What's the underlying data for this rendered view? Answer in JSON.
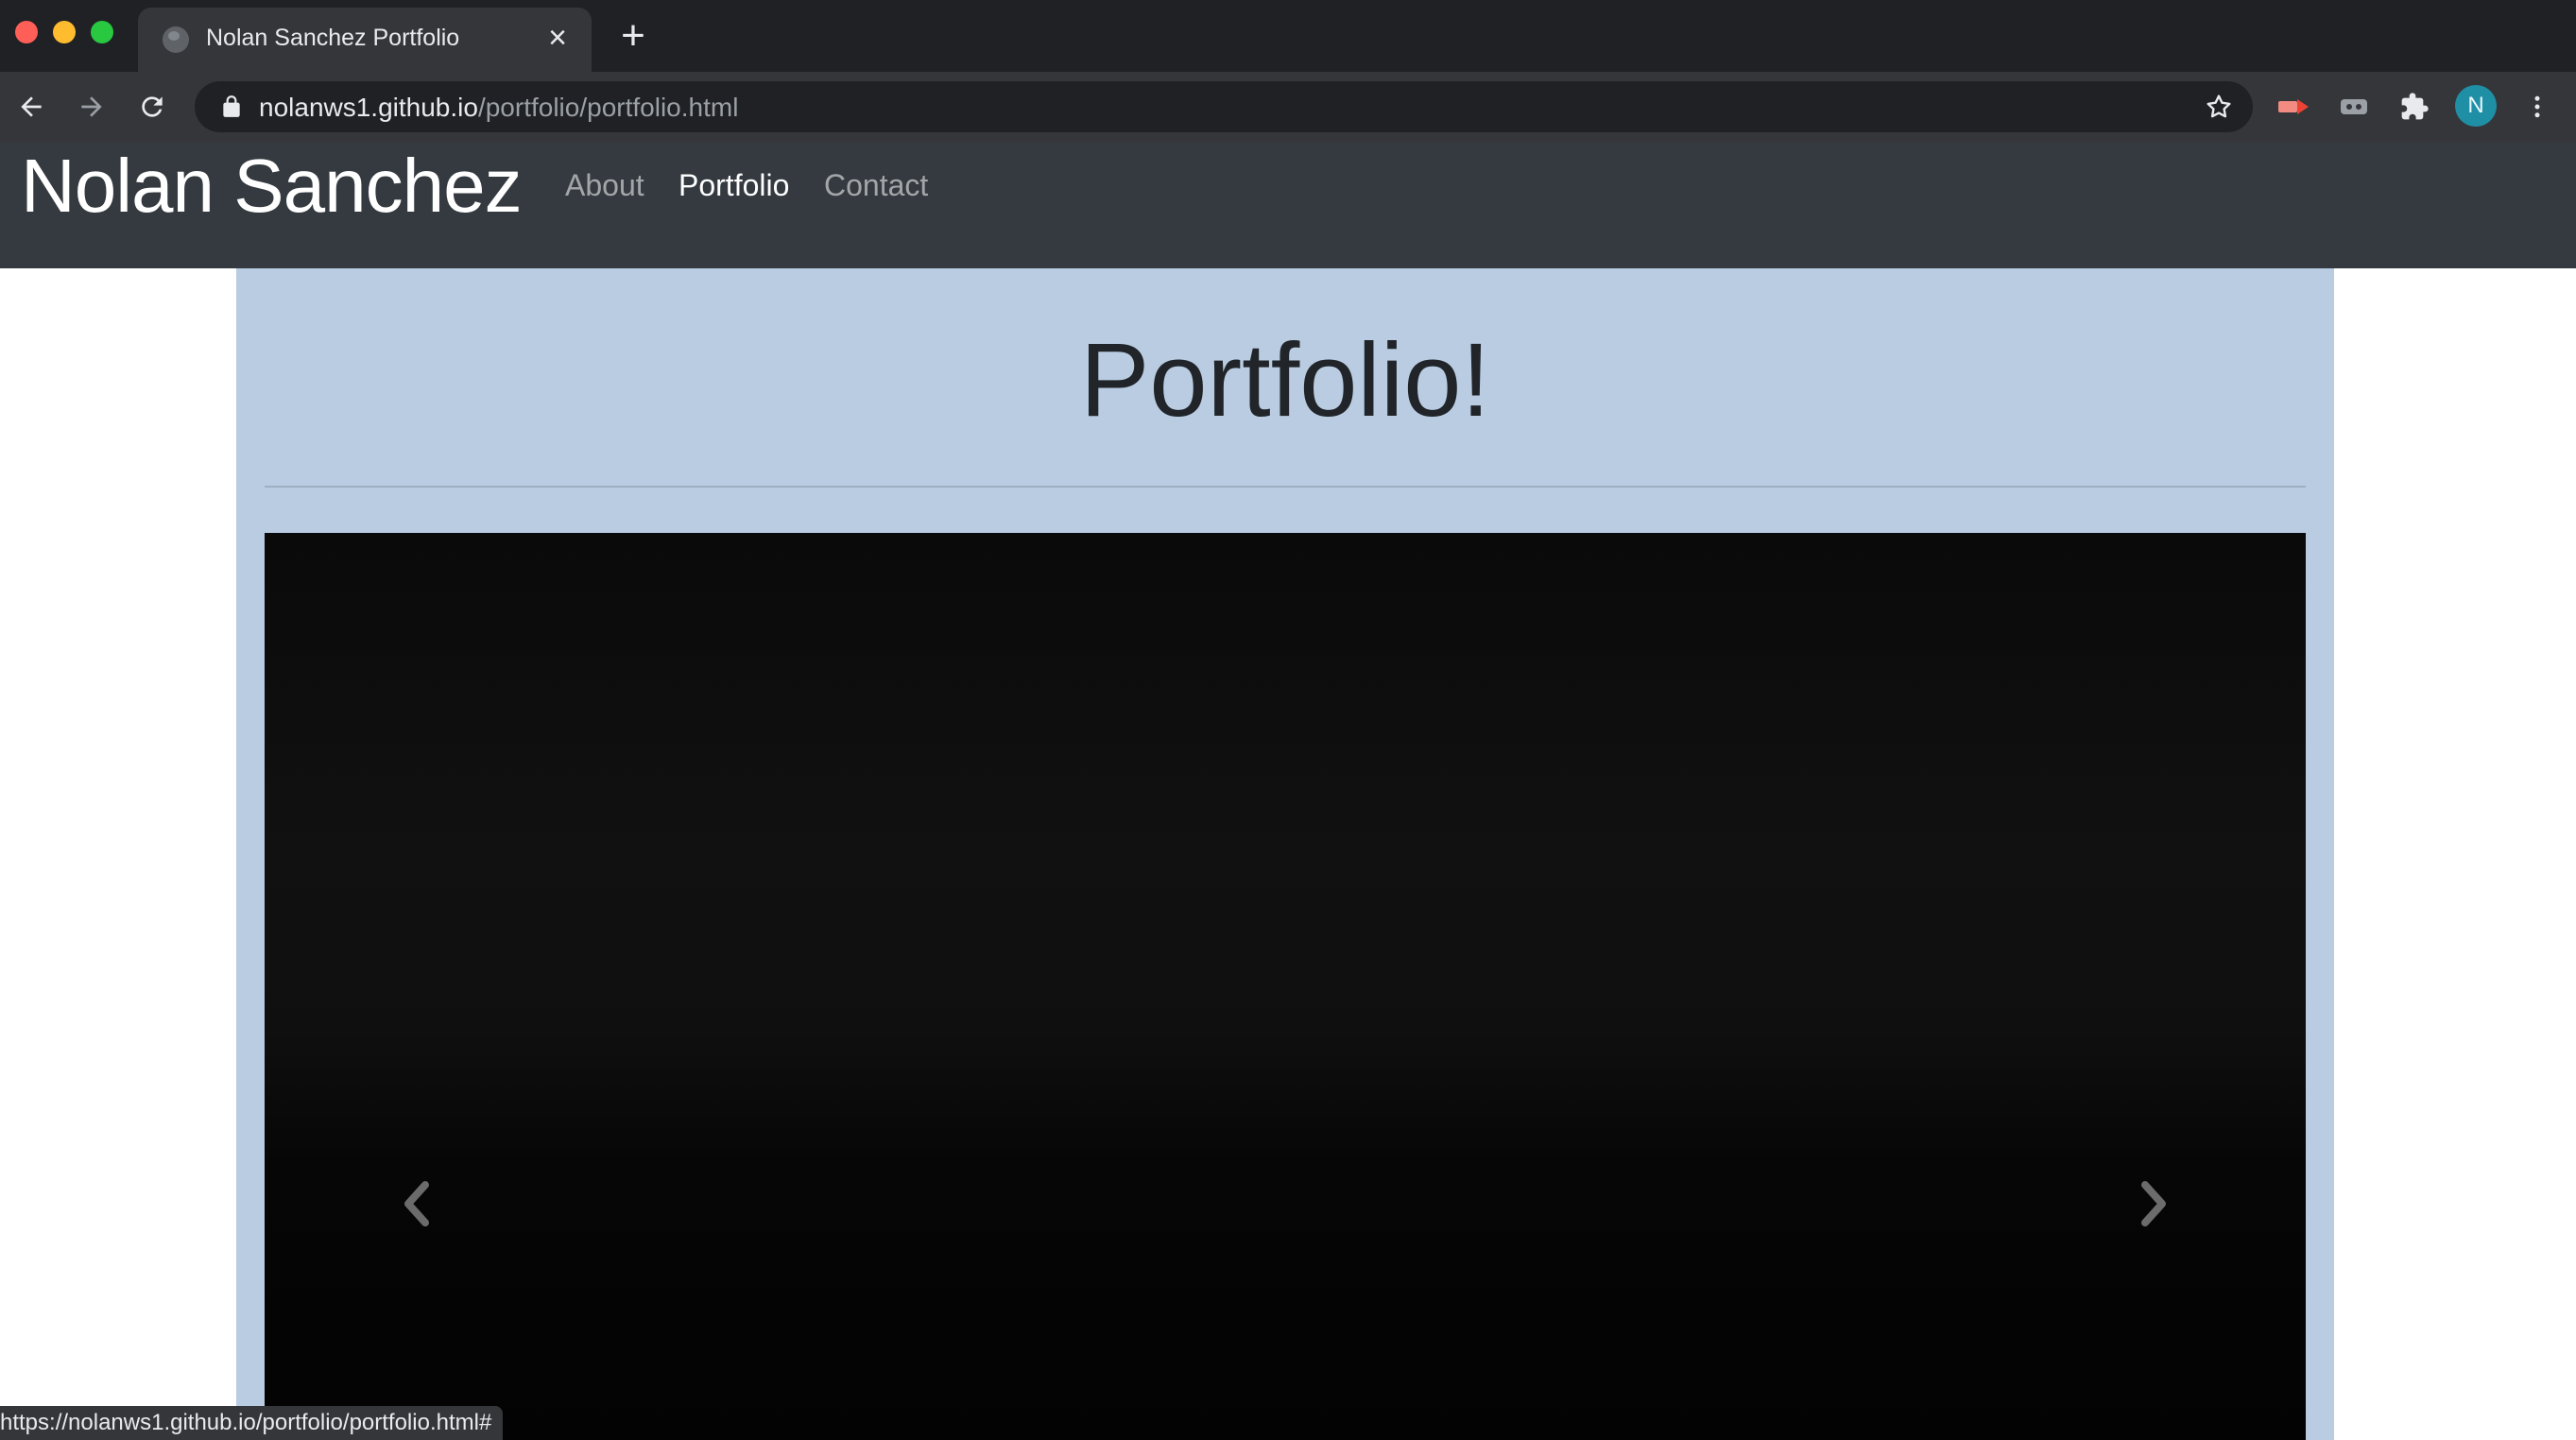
{
  "browser": {
    "tab": {
      "title": "Nolan Sanchez Portfolio"
    },
    "address": {
      "domain": "nolanws1.github.io",
      "path": "/portfolio/portfolio.html"
    },
    "profile_initial": "N",
    "status_url": "https://nolanws1.github.io/portfolio/portfolio.html#"
  },
  "site": {
    "brand": "Nolan Sanchez",
    "nav": {
      "about": "About",
      "portfolio": "Portfolio",
      "contact": "Contact"
    },
    "active_nav": "Portfolio"
  },
  "main": {
    "heading": "Portfolio!"
  },
  "colors": {
    "navbar": "#343a40",
    "content_background": "#b9cce2",
    "carousel_background": "#0b0b0b"
  }
}
